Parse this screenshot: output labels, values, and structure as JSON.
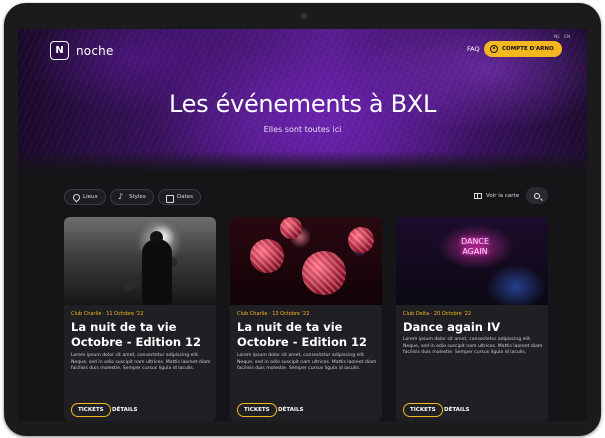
{
  "header": {
    "logo_glyph": "N",
    "logo_text": "noche",
    "faq_label": "FAQ",
    "account_label": "COMPTE D'ARNO",
    "lang_options": [
      "NL",
      "EN"
    ]
  },
  "hero": {
    "title": "Les événements à BXL",
    "subtitle": "Elles sont toutes ici"
  },
  "filters": {
    "places_label": "Lieux",
    "styles_label": "Styles",
    "dates_label": "Dates",
    "map_label": "Voir la carte"
  },
  "cards": [
    {
      "meta": "Club Charlie · 11 Octobre '22",
      "title": "La nuit de ta vie Octobre - Edition 12",
      "description": "Lorem ipsum dolor sit amet, consectetur adipiscing elit. Neque, sed in odio suscipit nam ultrices. Mattis laoreet diam facilisis duis molestie. Semper cursus ligula id iaculis.",
      "tickets_label": "TICKETS",
      "details_label": "DÉTAILS"
    },
    {
      "meta": "Club Charlie · 13 Octobre '22",
      "title": "La nuit de ta vie Octobre - Edition 12",
      "description": "Lorem ipsum dolor sit amet, consectetur adipiscing elit. Neque, sed in odio suscipit nam ultrices. Mattis laoreet diam facilisis duis molestie. Semper cursus ligula id iaculis.",
      "tickets_label": "TICKETS",
      "details_label": "DÉTAILS"
    },
    {
      "meta": "Club Delta · 20 Octobre '22",
      "title": "Dance again IV",
      "neon_sign": "DANCE AGAIN",
      "description": "Lorem ipsum dolor sit amet, consectetur adipiscing elit. Neque, sed in odio suscipit nam ultrices. Mattis laoreet diam facilisis duis molestie. Semper cursus ligula id iaculis.",
      "tickets_label": "TICKETS",
      "details_label": "DÉTAILS"
    }
  ],
  "colors": {
    "accent": "#f5b71f",
    "background": "#151518",
    "card": "#202024",
    "hero_purple": "#5a1d92"
  },
  "icons": [
    "user-icon",
    "pin-icon",
    "music-note-icon",
    "calendar-icon",
    "map-icon",
    "search-icon"
  ]
}
